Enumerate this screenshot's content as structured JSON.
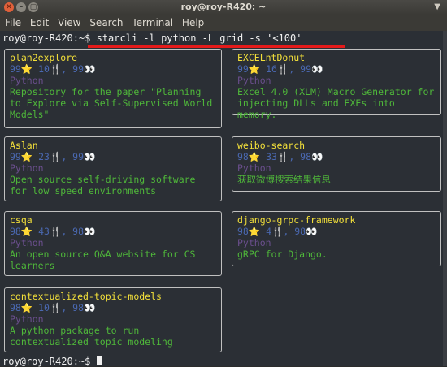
{
  "window": {
    "title": "roy@roy-R420: ~",
    "close_glyph": "✕",
    "min_glyph": "–",
    "max_glyph": "▢",
    "right_glyph": "▼"
  },
  "menu": [
    "File",
    "Edit",
    "View",
    "Search",
    "Terminal",
    "Help"
  ],
  "terminal": {
    "command_line": "roy@roy-R420:~$ starcli -l python -L grid -s '<100'",
    "final_prompt": "roy@roy-R420:~$ "
  },
  "repos": [
    {
      "name": "plan2explore",
      "stars": "99",
      "forks": "10",
      "watchers": "99",
      "language": "Python",
      "description": "Repository for the paper \"Planning to Explore via Self-Supervised World Models\""
    },
    {
      "name": "EXCELntDonut",
      "stars": "99",
      "forks": "16",
      "watchers": "99",
      "language": "Python",
      "description": "Excel 4.0 (XLM) Macro Generator for injecting DLLs and EXEs into memory."
    },
    {
      "name": "Aslan",
      "stars": "99",
      "forks": "23",
      "watchers": "99",
      "language": "Python",
      "description": "Open source self-driving software for low speed environments"
    },
    {
      "name": "weibo-search",
      "stars": "98",
      "forks": "33",
      "watchers": "98",
      "language": "Python",
      "description": "获取微博搜索结果信息"
    },
    {
      "name": "csqa",
      "stars": "98",
      "forks": "43",
      "watchers": "98",
      "language": "Python",
      "description": "An open source Q&A website for CS learners"
    },
    {
      "name": "django-grpc-framework",
      "stars": "98",
      "forks": "4",
      "watchers": "98",
      "language": "Python",
      "description": "gRPC for Django."
    },
    {
      "name": "contextualized-topic-models",
      "stars": "98",
      "forks": "10",
      "watchers": "98",
      "language": "Python",
      "description": "A python package to run contextualized topic modeling"
    }
  ],
  "icons": {
    "star": "⭐",
    "fork": "🍴",
    "watchers": "👀"
  }
}
